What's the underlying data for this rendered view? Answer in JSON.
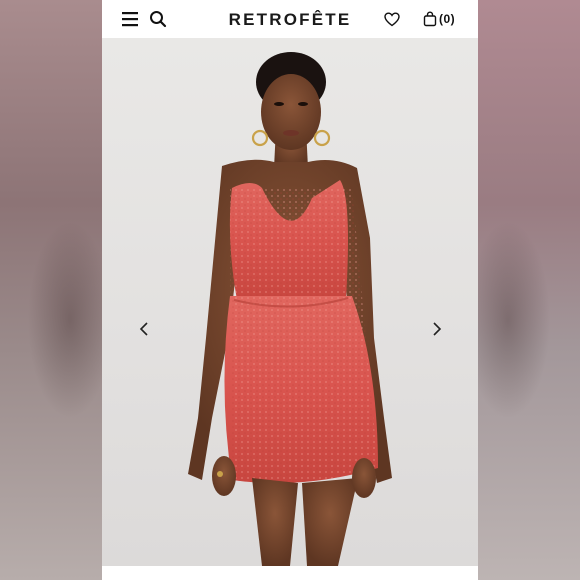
{
  "header": {
    "brand": "RETROFÊTE",
    "bag_count": "(0)",
    "icons": [
      "menu-icon",
      "search-icon",
      "heart-icon",
      "bag-icon"
    ]
  },
  "gallery": {
    "image": "model-in-coral-sequin-cowl-neck-mini-dress",
    "prev_icon": "chevron-left-icon",
    "next_icon": "chevron-right-icon"
  },
  "colors": {
    "background": "#e4e2e1",
    "header": "#ffffff",
    "dress": "#d9544e",
    "text": "#1a1a1a"
  }
}
